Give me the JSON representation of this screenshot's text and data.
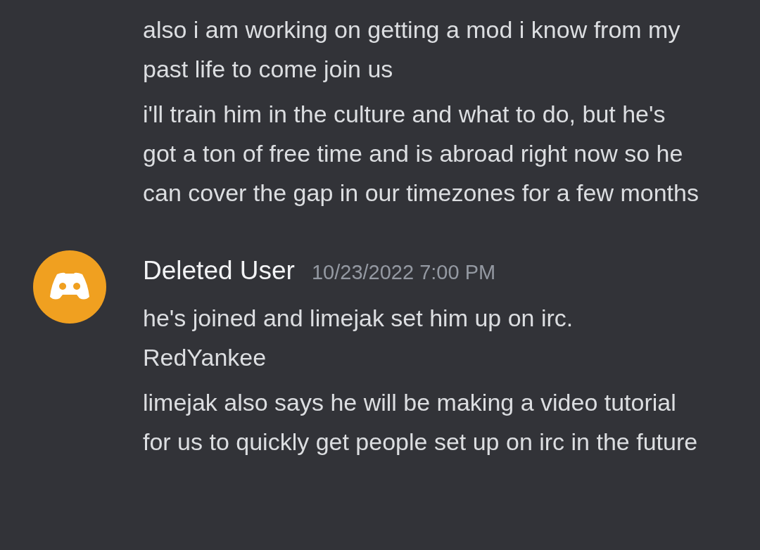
{
  "groups": [
    {
      "messages": [
        {
          "text": "also i am working on getting a mod i know from my past life to come join us"
        },
        {
          "text": "i'll train him in the culture and what to do, but he's got a ton of free time and is abroad right now so he can cover the gap in our timezones for a few months"
        }
      ]
    },
    {
      "author": "Deleted User",
      "timestamp": "10/23/2022 7:00 PM",
      "messages": [
        {
          "text": "he's joined and limejak set him up on irc. RedYankee"
        },
        {
          "text": "limejak also says he will be making a video tutorial for us to quickly get people set up on irc in the future"
        }
      ]
    }
  ]
}
